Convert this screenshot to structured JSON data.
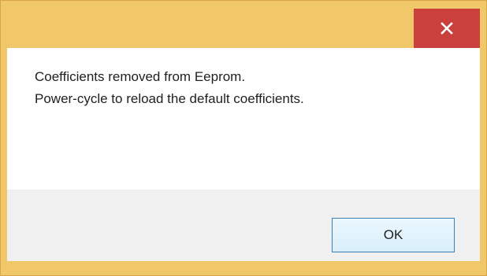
{
  "dialog": {
    "close_icon": "close-icon",
    "message_lines": [
      "Coefficients removed from Eeprom.",
      "Power-cycle to reload the default coefficients."
    ],
    "ok_label": "OK"
  },
  "colors": {
    "frame": "#f1c869",
    "close_button": "#c9403c",
    "content_background": "#ffffff",
    "footer_background": "#f0f0f0",
    "button_border": "#3c7fb1"
  }
}
